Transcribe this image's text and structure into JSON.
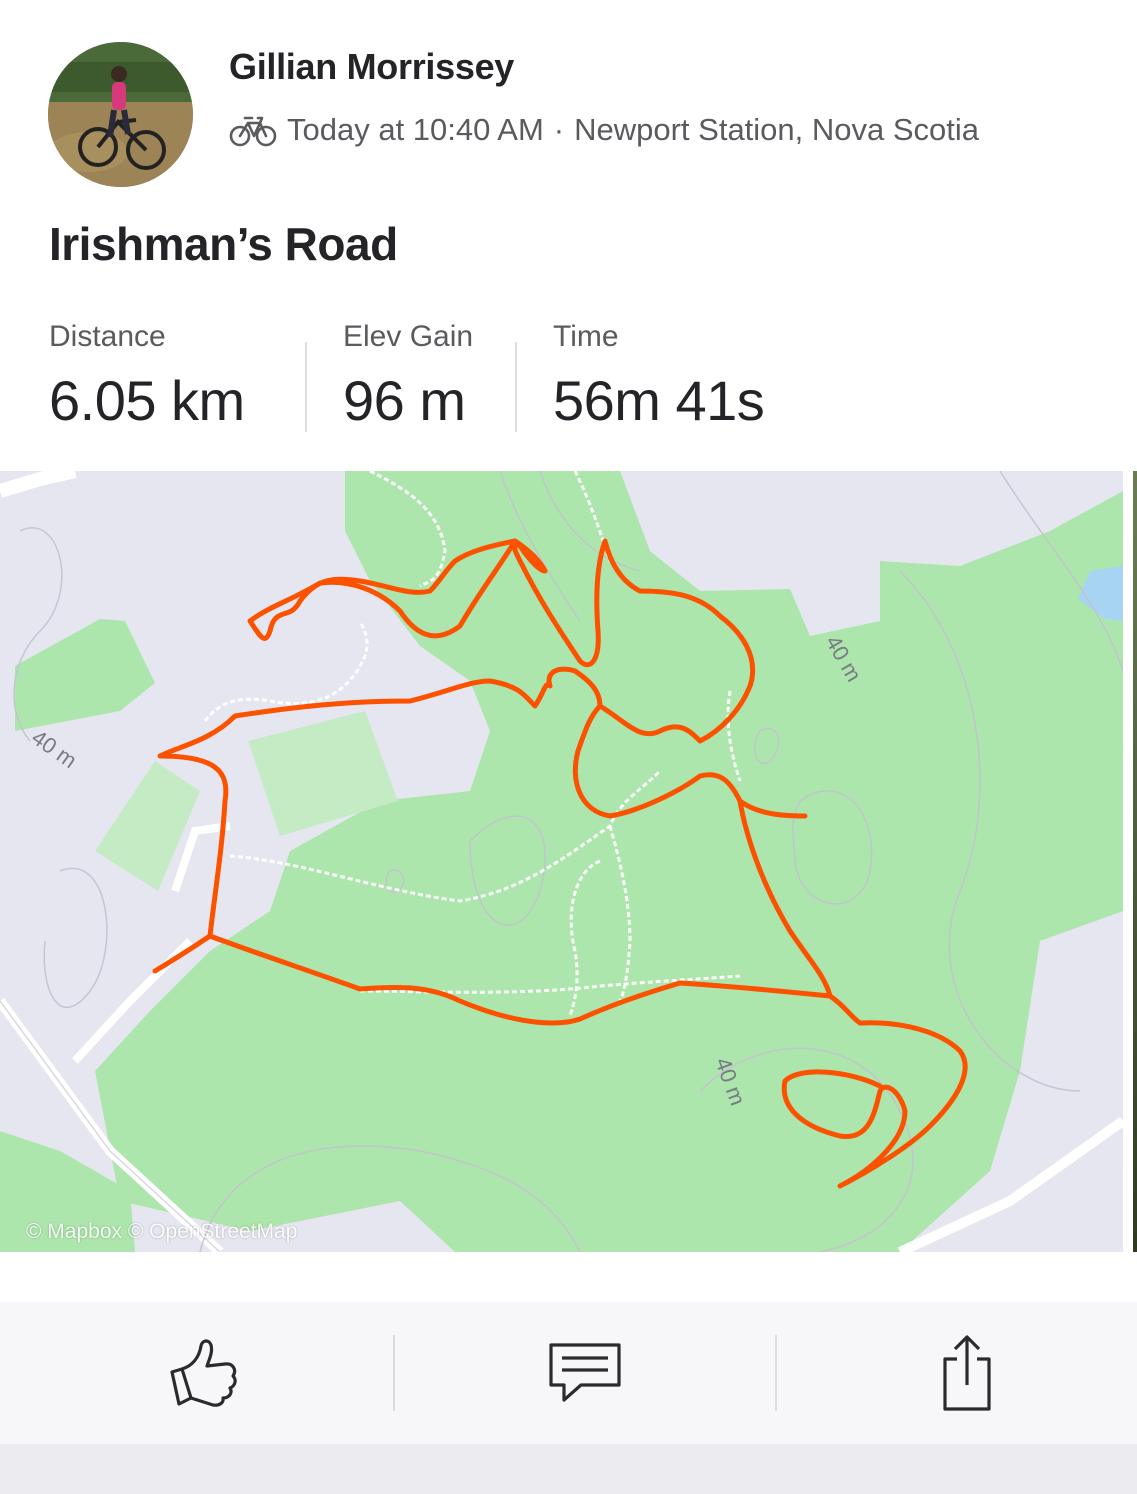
{
  "athlete": {
    "name": "Gillian Morrissey",
    "activity_type_icon": "bike-icon",
    "timestamp": "Today at 10:40 AM",
    "separator": "·",
    "location": "Newport Station, Nova Scotia"
  },
  "activity": {
    "title": "Irishman’s Road"
  },
  "stats": [
    {
      "label": "Distance",
      "value": "6.05 km"
    },
    {
      "label": "Elev Gain",
      "value": "96 m"
    },
    {
      "label": "Time",
      "value": "56m 41s"
    }
  ],
  "map": {
    "contour_label": "40 m",
    "attribution": "© Mapbox © OpenStreetMap",
    "colors": {
      "route": "#fc5200",
      "land": "#e6e6f0",
      "forest": "#ade6ad",
      "forest_light": "#c4ebc4",
      "water": "#a6d4f2",
      "trail": "#ffffff"
    }
  },
  "actions": [
    {
      "name": "kudos",
      "icon": "thumbs-up-icon"
    },
    {
      "name": "comment",
      "icon": "comment-icon"
    },
    {
      "name": "share",
      "icon": "share-icon"
    }
  ]
}
